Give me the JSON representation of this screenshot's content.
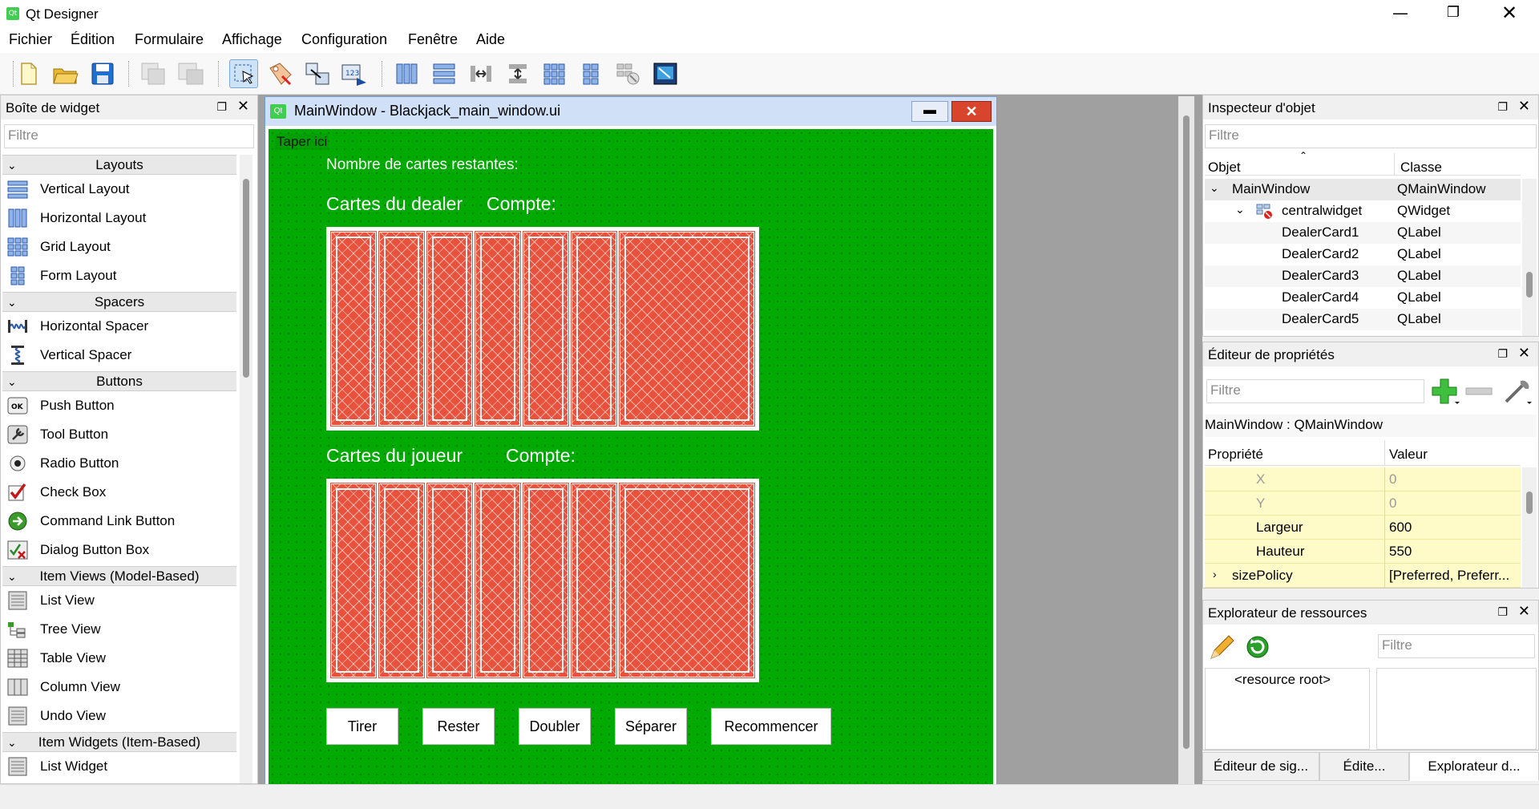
{
  "window": {
    "title": "Qt Designer",
    "app_icon": "qt-icon"
  },
  "menu": [
    "Fichier",
    "Édition",
    "Formulaire",
    "Affichage",
    "Configuration",
    "Fenêtre",
    "Aide"
  ],
  "widget_box": {
    "title": "Boîte de widget",
    "filter_placeholder": "Filtre",
    "categories": [
      {
        "label": "Layouts",
        "items": [
          "Vertical Layout",
          "Horizontal Layout",
          "Grid Layout",
          "Form Layout"
        ]
      },
      {
        "label": "Spacers",
        "items": [
          "Horizontal Spacer",
          "Vertical Spacer"
        ]
      },
      {
        "label": "Buttons",
        "items": [
          "Push Button",
          "Tool Button",
          "Radio Button",
          "Check Box",
          "Command Link Button",
          "Dialog Button Box"
        ]
      },
      {
        "label": "Item Views (Model-Based)",
        "items": [
          "List View",
          "Tree View",
          "Table View",
          "Column View",
          "Undo View"
        ]
      },
      {
        "label": "Item Widgets (Item-Based)",
        "items": [
          "List Widget"
        ]
      }
    ]
  },
  "form_window": {
    "title": "MainWindow - Blackjack_main_window.ui",
    "menu_placeholder": "Taper ici",
    "remaining_cards_label": "Nombre de cartes restantes:",
    "dealer_label": "Cartes du dealer",
    "dealer_count_label": "Compte:",
    "player_label": "Cartes du joueur",
    "player_count_label": "Compte:",
    "buttons": [
      "Tirer",
      "Rester",
      "Doubler",
      "Séparer",
      "Recommencer"
    ],
    "bg_color": "#00aa00",
    "card_color": "#e8523c"
  },
  "object_inspector": {
    "title": "Inspecteur d'objet",
    "filter_placeholder": "Filtre",
    "col_object": "Objet",
    "col_class": "Classe",
    "rows": [
      {
        "object": "MainWindow",
        "class": "QMainWindow"
      },
      {
        "object": "centralwidget",
        "class": "QWidget"
      },
      {
        "object": "DealerCard1",
        "class": "QLabel"
      },
      {
        "object": "DealerCard2",
        "class": "QLabel"
      },
      {
        "object": "DealerCard3",
        "class": "QLabel"
      },
      {
        "object": "DealerCard4",
        "class": "QLabel"
      },
      {
        "object": "DealerCard5",
        "class": "QLabel"
      }
    ]
  },
  "property_editor": {
    "title": "Éditeur de propriétés",
    "filter_placeholder": "Filtre",
    "context": "MainWindow : QMainWindow",
    "col_property": "Propriété",
    "col_value": "Valeur",
    "rows": [
      {
        "name": "X",
        "value": "0"
      },
      {
        "name": "Y",
        "value": "0"
      },
      {
        "name": "Largeur",
        "value": "600"
      },
      {
        "name": "Hauteur",
        "value": "550"
      },
      {
        "name": "sizePolicy",
        "value": "[Preferred, Preferr..."
      }
    ]
  },
  "resource_explorer": {
    "title": "Explorateur de ressources",
    "filter_placeholder": "Filtre",
    "root": "<resource root>"
  },
  "bottom_tabs": [
    "Éditeur de sig...",
    "Édite...",
    "Explorateur d..."
  ]
}
